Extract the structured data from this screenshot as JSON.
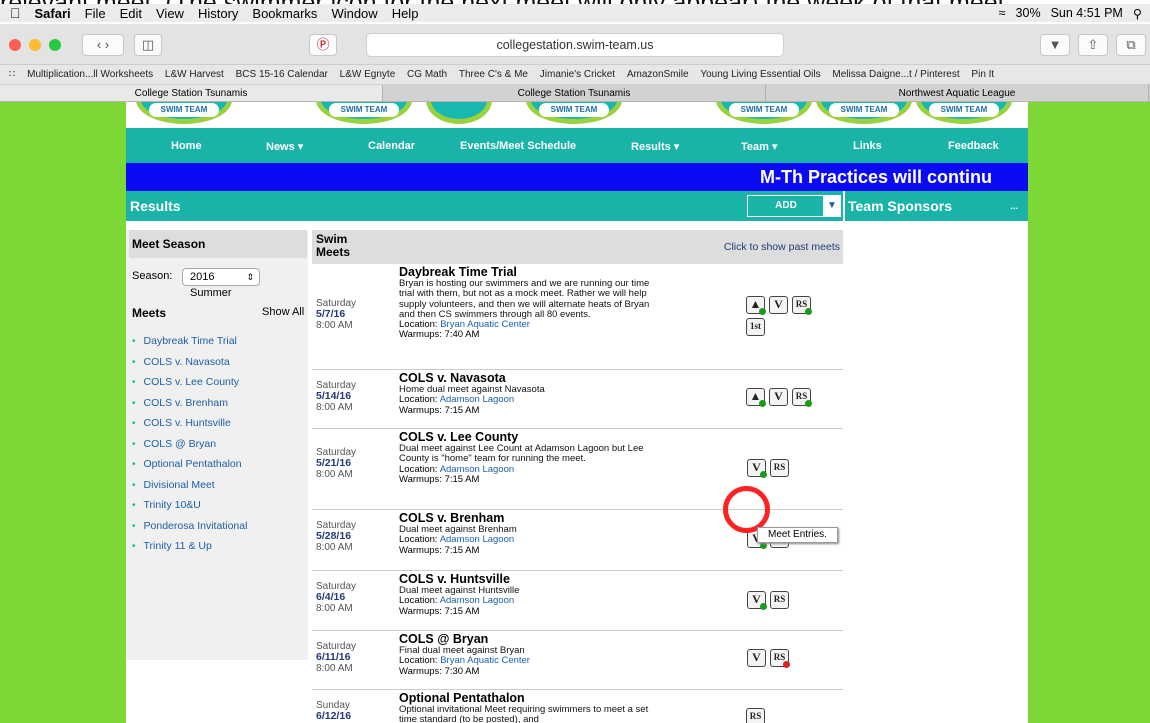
{
  "caption": "relevant meet. (The swimmer icon for the next meet will only appear) the week of that meet",
  "menubar": {
    "app": "Safari",
    "items": [
      "File",
      "Edit",
      "View",
      "History",
      "Bookmarks",
      "Window",
      "Help"
    ],
    "battery": "30%",
    "clock": "Sun 4:51 PM"
  },
  "toolbar": {
    "url": "collegestation.swim-team.us"
  },
  "bookmarks": [
    "Multiplication...ll Worksheets",
    "L&W Harvest",
    "BCS 15-16 Calendar",
    "L&W Egnyte",
    "CG Math",
    "Three C's & Me",
    "Jimanie's Cricket",
    "AmazonSmile",
    "Young Living Essential Oils",
    "Melissa Daigne...t / Pinterest",
    "Pin It"
  ],
  "tabs": [
    "College Station Tsunamis",
    "College Station Tsunamis",
    "Northwest Aquatic League"
  ],
  "banner": {
    "logo_text": "SWIM TEAM"
  },
  "nav": [
    "Home",
    "News ▾",
    "Calendar",
    "Events/Meet Schedule",
    "Results ▾",
    "Team ▾",
    "Links",
    "Feedback"
  ],
  "marquee": "M-Th Practices will continu",
  "results": {
    "title": "Results",
    "add": "ADD",
    "sponsors": "Team Sponsors",
    "sponsors_more": "..."
  },
  "sidebar": {
    "season_header": "Meet Season",
    "season_label": "Season:",
    "season_value": "2016 Summer",
    "meets_header": "Meets",
    "show_all": "Show All",
    "meets": [
      "Daybreak Time Trial",
      "COLS v. Navasota",
      "COLS v. Lee County",
      "COLS v. Brenham",
      "COLS v. Huntsville",
      "COLS @ Bryan",
      "Optional Pentathalon",
      "Divisional Meet",
      "Trinity 10&U",
      "Ponderosa Invitational",
      "Trinity 11 & Up"
    ]
  },
  "swim": {
    "header": "Swim Meets",
    "past_link": "Click to show past meets",
    "tooltip": "Meet Entries.",
    "meets": [
      {
        "day": "Saturday",
        "date": "5/7/16",
        "time": "8:00 AM",
        "title": "Daybreak Time Trial",
        "desc": "Bryan is hosting our swimmers and we are running our time trial with them, but not as a mock meet. Rather we will help supply volunteers, and then we will alternate heats of Bryan and then CS swimmers through all 80 events.",
        "loc_label": "Location:",
        "loc": "Bryan Aquatic Center",
        "warmups": "Warmups: 7:40 AM"
      },
      {
        "day": "Saturday",
        "date": "5/14/16",
        "time": "8:00 AM",
        "title": "COLS v. Navasota",
        "desc": "Home dual meet against Navasota",
        "loc_label": "Location:",
        "loc": "Adamson Lagoon",
        "warmups": "Warmups: 7:15 AM"
      },
      {
        "day": "Saturday",
        "date": "5/21/16",
        "time": "8:00 AM",
        "title": "COLS v. Lee County",
        "desc": "Dual meet against Lee Count at Adamson Lagoon but Lee County is \"home\" team for running the meet.",
        "loc_label": "Location:",
        "loc": "Adamson Lagoon",
        "warmups": "Warmups: 7:15 AM"
      },
      {
        "day": "Saturday",
        "date": "5/28/16",
        "time": "8:00 AM",
        "title": "COLS v. Brenham",
        "desc": "Dual meet against Brenham",
        "loc_label": "Location:",
        "loc": "Adamson Lagoon",
        "warmups": "Warmups: 7:15 AM"
      },
      {
        "day": "Saturday",
        "date": "6/4/16",
        "time": "8:00 AM",
        "title": "COLS v. Huntsville",
        "desc": "Dual meet against Huntsville",
        "loc_label": "Location:",
        "loc": "Adamson Lagoon",
        "warmups": "Warmups: 7:15 AM"
      },
      {
        "day": "Saturday",
        "date": "6/11/16",
        "time": "8:00 AM",
        "title": "COLS @ Bryan",
        "desc": "Final dual meet against Bryan",
        "loc_label": "Location:",
        "loc": "Bryan Aquatic Center",
        "warmups": "Warmups: 7:30 AM"
      },
      {
        "day": "Sunday",
        "date": "6/12/16",
        "time": "",
        "title": "Optional Pentathalon",
        "desc": "Optional invitational Meet requiring swimmers to meet a set time standard (to be posted), and",
        "loc_label": "",
        "loc": "",
        "warmups": ""
      }
    ]
  },
  "icons": {
    "v": "V",
    "rs": "RS",
    "first": "1st"
  }
}
